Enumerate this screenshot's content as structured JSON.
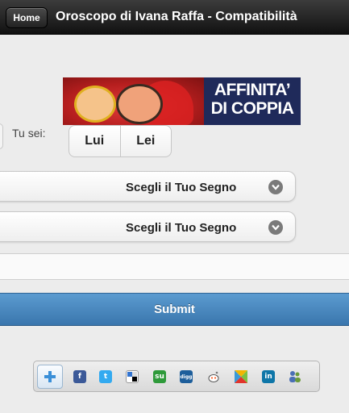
{
  "header": {
    "home_label": "Home",
    "title": "Oroscopo di Ivana Raffa - Compatibilità"
  },
  "banner": {
    "line1": "AFFINITA’",
    "line2": "DI COPPIA"
  },
  "gender": {
    "label": "Tu sei:",
    "options": [
      "Lui",
      "Lei"
    ]
  },
  "sign_selects": [
    {
      "label": "Scegli il Tuo Segno"
    },
    {
      "label": "Scegli il Tuo Segno"
    }
  ],
  "submit_label": "Submit",
  "share": {
    "services": [
      "facebook",
      "twitter",
      "delicious",
      "stumbleupon",
      "digg",
      "reddit",
      "kaboodle",
      "linkedin",
      "myspace"
    ]
  },
  "colors": {
    "header_bg": "#1a1a1a",
    "submit_bg": "#4a88c0",
    "page_bg": "#ececec"
  }
}
